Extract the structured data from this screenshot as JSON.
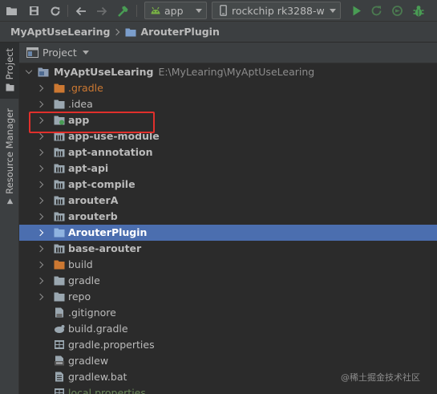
{
  "toolbar": {
    "run_config": "app",
    "device": "rockchip rk3288-w",
    "icons": [
      "folder-open-icon",
      "save-icon",
      "sync-icon",
      "back-icon",
      "forward-icon",
      "make-hammer-icon",
      "android-icon",
      "device-icon",
      "run-icon",
      "apply-changes-icon",
      "debug-icon",
      "bug-icon"
    ]
  },
  "breadcrumb": {
    "root": "MyAptUseLearing",
    "current": "ArouterPlugin"
  },
  "sidebar": {
    "project_tab": "Project",
    "resource_tab": "Resource Manager"
  },
  "panel": {
    "view_mode": "Project"
  },
  "tree": {
    "root": {
      "name": "MyAptUseLearing",
      "path": "E:\\MyLearing\\MyAptUseLearing"
    },
    "items": [
      {
        "label": "gradle",
        "prefix": ".",
        "kind": "folder-orange",
        "expandable": true
      },
      {
        "label": ".idea",
        "kind": "folder",
        "expandable": true
      },
      {
        "label": "app",
        "kind": "module-app",
        "expandable": true,
        "bold": true
      },
      {
        "label": "app-use-module",
        "kind": "module",
        "expandable": true,
        "bold": true
      },
      {
        "label": "apt-annotation",
        "kind": "module",
        "expandable": true,
        "bold": true
      },
      {
        "label": "apt-api",
        "kind": "module",
        "expandable": true,
        "bold": true
      },
      {
        "label": "apt-compile",
        "kind": "module",
        "expandable": true,
        "bold": true
      },
      {
        "label": "arouterA",
        "kind": "module",
        "expandable": true,
        "bold": true
      },
      {
        "label": "arouterb",
        "kind": "module",
        "expandable": true,
        "bold": true
      },
      {
        "label": "ArouterPlugin",
        "kind": "folder-blue",
        "expandable": true,
        "bold": true,
        "selected": true
      },
      {
        "label": "base-arouter",
        "kind": "module",
        "expandable": true,
        "bold": true
      },
      {
        "label": "build",
        "kind": "folder-orange",
        "expandable": true
      },
      {
        "label": "gradle",
        "kind": "folder",
        "expandable": true
      },
      {
        "label": "repo",
        "kind": "folder",
        "expandable": true
      },
      {
        "label": ".gitignore",
        "kind": "file-gitignore"
      },
      {
        "label": "build.gradle",
        "kind": "file-gradle"
      },
      {
        "label": "gradle.properties",
        "kind": "file-properties"
      },
      {
        "label": "gradlew",
        "kind": "file-exec"
      },
      {
        "label": "gradlew.bat",
        "kind": "file-text"
      },
      {
        "label": "local.properties",
        "kind": "file-properties"
      }
    ]
  },
  "watermark": "@稀土掘金技术社区",
  "colors": {
    "selection": "#4b6eaf",
    "highlight_border": "#e0302c",
    "excluded_folder": "#cc7832",
    "run_green": "#499c54"
  }
}
